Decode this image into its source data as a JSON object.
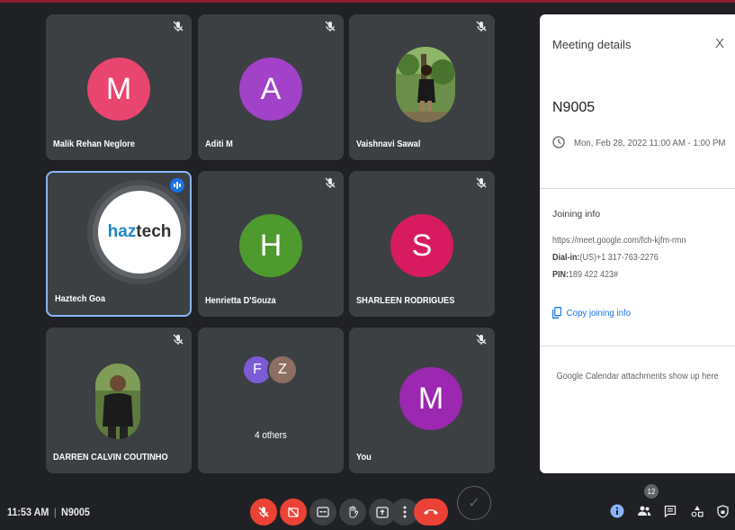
{
  "meeting_code": "N9005",
  "tiles": [
    {
      "name": "Malik Rehan Neglore",
      "initial": "M",
      "color": "#e8456f"
    },
    {
      "name": "Aditi M",
      "initial": "A",
      "color": "#a142c9"
    },
    {
      "name": "Vaishnavi Sawal"
    },
    {
      "name": "Haztech Goa",
      "logo": "haztech"
    },
    {
      "name": "Henrietta D'Souza",
      "initial": "H",
      "color": "#4f9a2e"
    },
    {
      "name": "SHARLEEN RODRIGUES",
      "initial": "S",
      "color": "#d81b60"
    },
    {
      "name": "DARREN CALVIN COUTINHO"
    },
    {
      "others_label": "4 others",
      "initials": [
        "F",
        "Z"
      ],
      "colors": [
        "#7c5cd6",
        "#8d6e63"
      ]
    },
    {
      "name": "You",
      "initial": "M",
      "color": "#9c27b0"
    }
  ],
  "panel": {
    "title": "Meeting details",
    "close": "X",
    "code": "N9005",
    "datetime": "Mon, Feb 28, 2022 11:00 AM - 1:00 PM",
    "joining_title": "Joining info",
    "link": "https://meet.google.com/fch-kjfm-rmn",
    "dialin_label": "Dial-in:",
    "dialin_value": "(US)+1 317-763-2276",
    "pin_label": "PIN:",
    "pin_value": "189 422 423#",
    "copy_label": "Copy joining info",
    "calendar_note": "Google Calendar attachments show up here"
  },
  "bottom": {
    "time": "11:53 AM",
    "separator": "|",
    "code": "N9005",
    "people_count": "12"
  },
  "colors": {
    "accent": "#1a73e8",
    "danger": "#ea4335",
    "tile": "#3c4043",
    "background": "#202124"
  }
}
